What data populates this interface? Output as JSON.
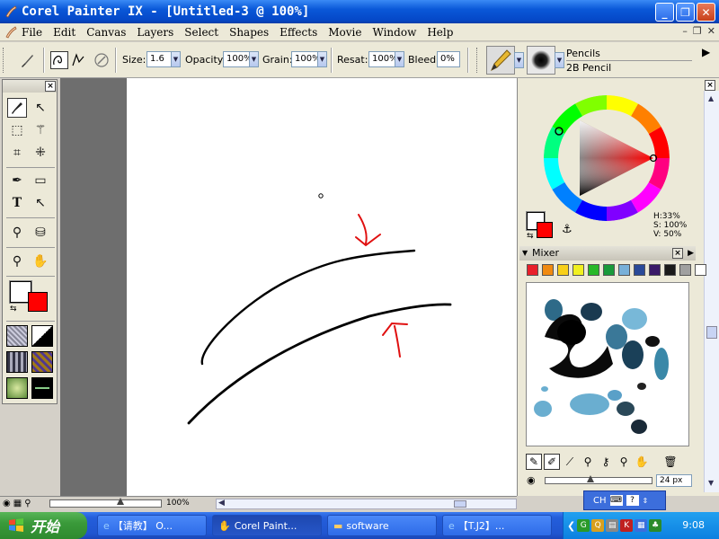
{
  "window": {
    "title": "Corel Painter IX - [Untitled-3 @ 100%]",
    "buttons": {
      "minimize": "_",
      "restore": "❐",
      "close": "✕"
    }
  },
  "menu": {
    "items": [
      {
        "label": "File"
      },
      {
        "label": "Edit"
      },
      {
        "label": "Canvas"
      },
      {
        "label": "Layers"
      },
      {
        "label": "Select"
      },
      {
        "label": "Shapes"
      },
      {
        "label": "Effects"
      },
      {
        "label": "Movie"
      },
      {
        "label": "Window"
      },
      {
        "label": "Help"
      }
    ],
    "mdi": {
      "min": "–",
      "restore": "❐",
      "close": "✕"
    }
  },
  "propbar": {
    "size_label": "Size:",
    "size_value": "1.6",
    "opacity_label": "Opacity:",
    "opacity_value": "100%",
    "grain_label": "Grain:",
    "grain_value": "100%",
    "resat_label": "Resat:",
    "resat_value": "100%",
    "bleed_label": "Bleed:",
    "bleed_value": "0%",
    "brush_category": "Pencils",
    "brush_variant": "2B Pencil"
  },
  "status": {
    "zoom": "100%"
  },
  "colors": {
    "main": "#000000",
    "additional": "#ff0000",
    "h": "H:33%",
    "s": "S: 100%",
    "v": "V: 50%"
  },
  "mixer": {
    "title": "Mixer",
    "swatches": [
      "#e8202a",
      "#f08a10",
      "#f8d018",
      "#f0f020",
      "#28b828",
      "#1a9a3a",
      "#78b0d8",
      "#2a4a98",
      "#3a1a68",
      "#1a1a1a",
      "#a0a0a0",
      "#ffffff"
    ],
    "brush_size": "24 px"
  },
  "langbar": {
    "lang": "CH"
  },
  "taskbar": {
    "start": "开始",
    "tasks": [
      {
        "label": "【请教】 O..."
      },
      {
        "label": "Corel Paint..."
      },
      {
        "label": "software"
      },
      {
        "label": "【T.J2】..."
      }
    ],
    "clock": "9:08"
  }
}
